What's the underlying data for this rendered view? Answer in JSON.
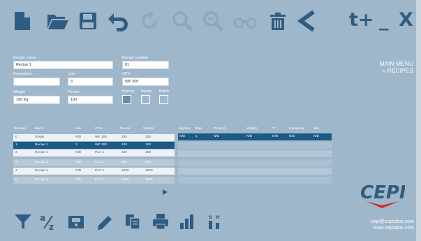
{
  "toolbar": {
    "icons": [
      "new-file-icon",
      "open-folder-icon",
      "save-icon",
      "undo-icon",
      "refresh-icon",
      "zoom-in-icon",
      "zoom-out-icon",
      "binoculars-icon",
      "delete-icon",
      "back-icon"
    ],
    "text_plus": "t+",
    "minimize": "_",
    "close": "X"
  },
  "form": {
    "recipe_name": {
      "label": "Recipe name",
      "value": "Recipe 1"
    },
    "recipe_number": {
      "label": "Recipe number",
      "value": "01"
    },
    "description": {
      "label": "Description",
      "value": ""
    },
    "line": {
      "label": "Line",
      "value": "3"
    },
    "cpu": {
      "label": "CPU",
      "value": "WP 300"
    },
    "weight": {
      "label": "Weight",
      "value": "100 Kg"
    },
    "pieces": {
      "label": "Pieces",
      "value": "100"
    },
    "checks": [
      {
        "label": "Interna",
        "checked": true
      },
      {
        "label": "Inssilo",
        "checked": false
      },
      {
        "label": "Batch",
        "checked": false
      }
    ]
  },
  "menu": {
    "title": "MAIN MENU",
    "subtitle": "» RECIPES"
  },
  "recipes_table": {
    "headers": [
      "Number",
      "Name",
      "Line",
      "CPU",
      "Pieces",
      "Weight"
    ],
    "rows": [
      [
        "0",
        "Single",
        "N/D",
        "WP 300",
        "200",
        "200"
      ],
      [
        "1",
        "Recipe 1",
        "3",
        "WP 300",
        "100",
        "100"
      ],
      [
        "2",
        "Recipe 2",
        "N/D",
        "PLC 1",
        "250",
        "250"
      ],
      [
        "3",
        "Recipe 3",
        "N/D",
        "PLC 1",
        "500",
        "500"
      ],
      [
        "4",
        "Recipe 4",
        "N/D",
        "PLC 1",
        "1000",
        "1000"
      ],
      [
        "5",
        "Recipe 5",
        "N/D",
        "PLC 1",
        "1500",
        "1500"
      ]
    ]
  },
  "steps_table": {
    "headers": [
      "Number",
      "Step",
      "Product",
      "Weight",
      "T°",
      "Unloading",
      "Silo"
    ],
    "rows": [
      [
        "N/D",
        "1",
        "N/D",
        "N/D",
        "N/D",
        "N/D",
        "N/D"
      ]
    ]
  },
  "bottom_toolbar": {
    "icons": [
      "filter-icon",
      "sort-az-icon",
      "export-icon",
      "edit-icon",
      "copy-icon",
      "print-icon",
      "chart-icon",
      "sort-numeric-icon"
    ],
    "sort_az_a": "a",
    "sort_az_z": "z",
    "sort_num_s": "s",
    "sort_num_n": "n"
  },
  "brand": {
    "logo_text": "CEPI",
    "email": "cepi@cepisilos.com",
    "website": "www.cepisilos.com",
    "primary_color": "#2f5d82",
    "logo_red": "#d02b27"
  }
}
